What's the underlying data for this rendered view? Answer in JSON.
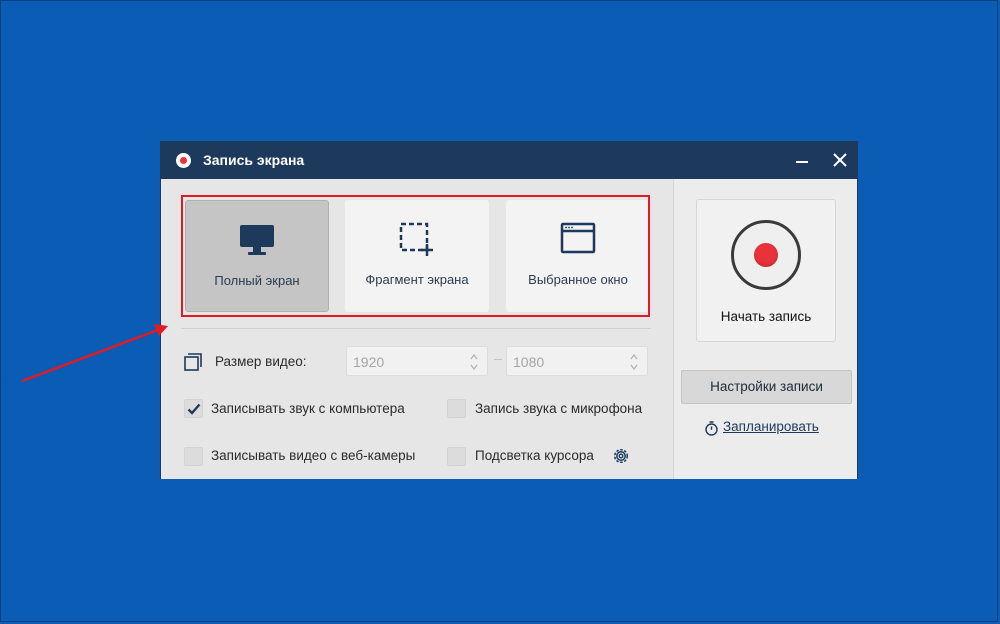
{
  "window": {
    "title": "Запись экрана"
  },
  "modes": [
    {
      "label": "Полный экран",
      "icon": "monitor-icon",
      "selected": true
    },
    {
      "label": "Фрагмент экрана",
      "icon": "crop-region-icon",
      "selected": false
    },
    {
      "label": "Выбранное окно",
      "icon": "window-icon",
      "selected": false
    }
  ],
  "video_size": {
    "label": "Размер видео:",
    "width": "1920",
    "height": "1080"
  },
  "options": [
    {
      "label": "Записывать звук с компьютера",
      "checked": true
    },
    {
      "label": "Запись звука с микрофона",
      "checked": false
    },
    {
      "label": "Записывать видео с веб-камеры",
      "checked": false
    },
    {
      "label": "Подсветка курсора",
      "checked": false
    }
  ],
  "actions": {
    "start_label": "Начать запись",
    "settings_label": "Настройки записи",
    "schedule_label": "Запланировать"
  },
  "colors": {
    "desktop": "#0a5cb4",
    "titlebar": "#1d3a5c",
    "highlight": "#e21b22",
    "record": "#e8333a"
  }
}
